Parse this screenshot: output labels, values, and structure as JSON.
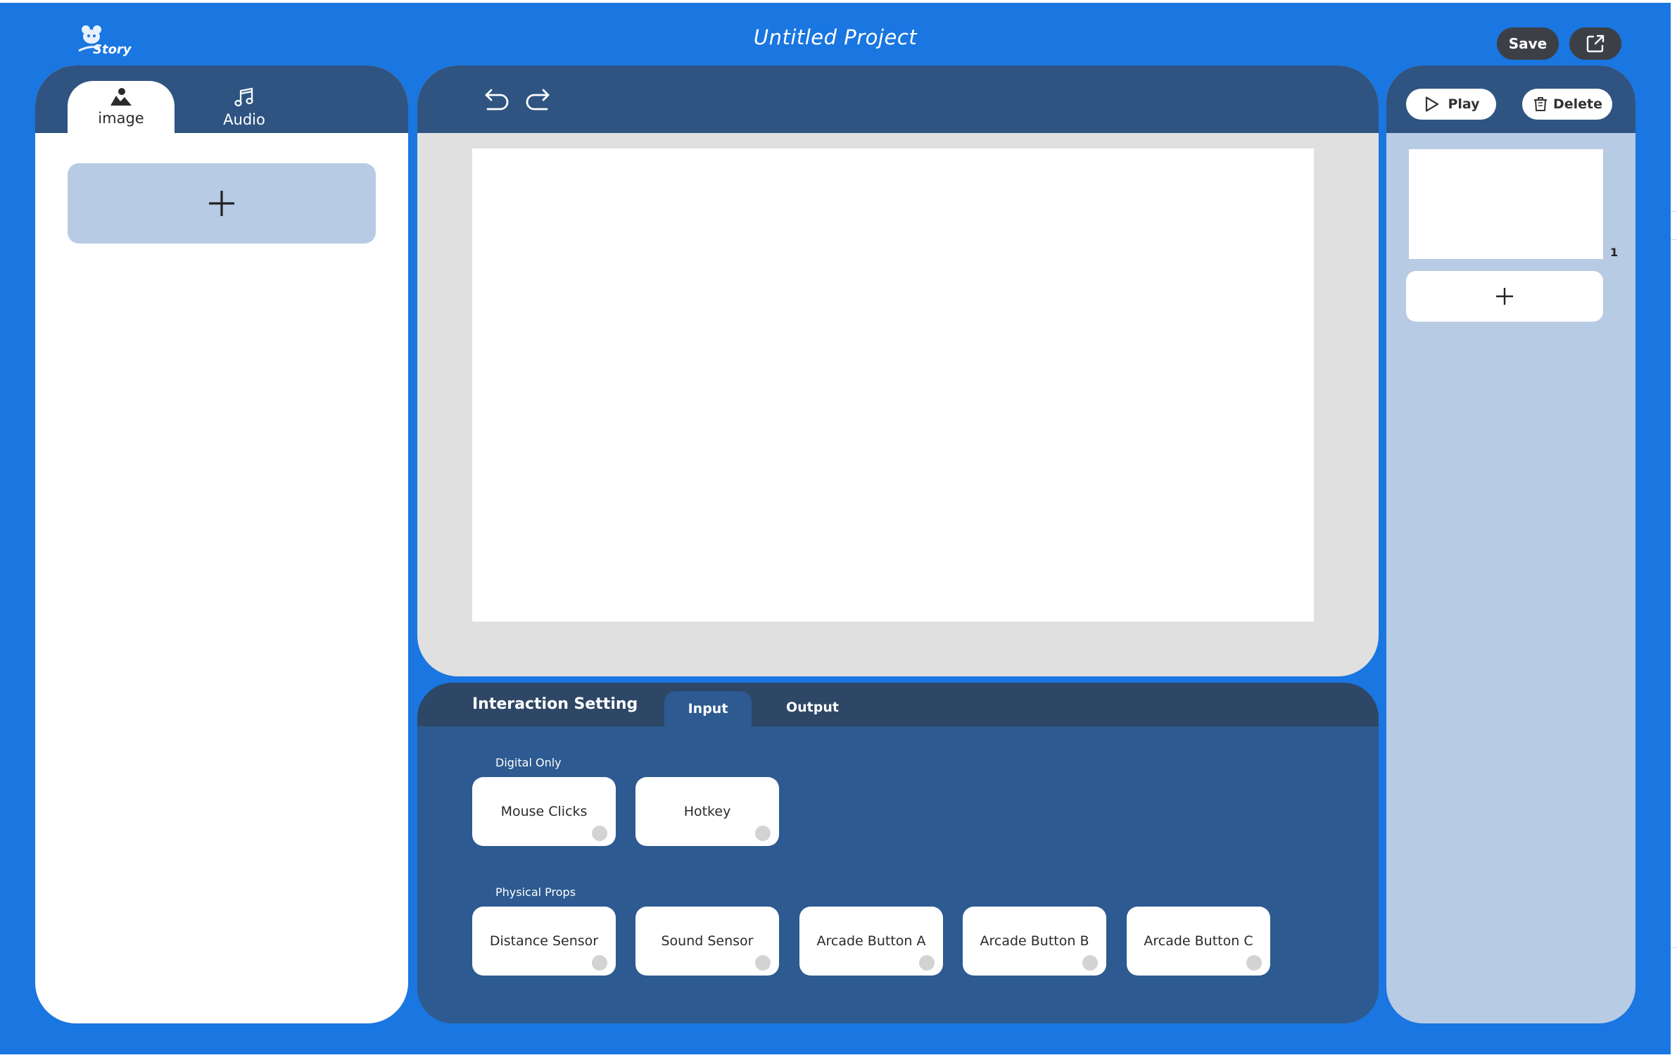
{
  "header": {
    "logo_text": "Story",
    "project_title": "Untitled Project",
    "save_label": "Save"
  },
  "asset_panel": {
    "tabs": [
      {
        "label": "image",
        "icon": "image-icon",
        "active": true
      },
      {
        "label": "Audio",
        "icon": "music-note-icon",
        "active": false
      }
    ],
    "add_icon": "plus-icon"
  },
  "canvas": {
    "undo_icon": "undo-icon",
    "redo_icon": "redo-icon"
  },
  "interaction": {
    "title": "Interaction Setting",
    "tabs": [
      {
        "label": "Input",
        "active": true
      },
      {
        "label": "Output",
        "active": false
      }
    ],
    "groups": [
      {
        "label": "Digital Only",
        "items": [
          "Mouse Clicks",
          "Hotkey"
        ]
      },
      {
        "label": "Physical Props",
        "items": [
          "Distance Sensor",
          "Sound Sensor",
          "Arcade Button A",
          "Arcade Button B",
          "Arcade Button C"
        ]
      }
    ]
  },
  "scenes": {
    "play_label": "Play",
    "delete_label": "Delete",
    "items": [
      {
        "number": "1"
      }
    ]
  },
  "colors": {
    "background": "#1a76e0",
    "panel_header": "#2f5481",
    "interaction_body": "#2d5a90",
    "light_panel": "#b8cbe5",
    "dark_button": "#3c3f45"
  }
}
